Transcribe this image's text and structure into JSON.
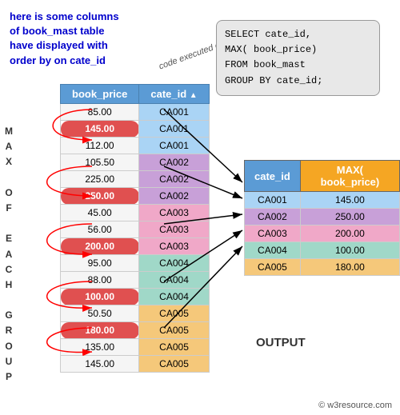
{
  "annotation": {
    "line1": "here is some columns",
    "line2": "of book_mast table",
    "line3": "have displayed with",
    "line4": "order by on cate_id"
  },
  "code_label": "code executed on this table",
  "sql": {
    "lines": [
      "SELECT cate_id,",
      "MAX( book_price)",
      "FROM book_mast",
      "GROUP BY cate_id;"
    ]
  },
  "side_label": "M\nA\nX\n \nO\nF\n \nE\nA\nC\nH\n \nG\nR\nO\nU\nP",
  "main_table": {
    "headers": [
      "book_price",
      "cate_id"
    ],
    "rows": [
      {
        "price": "85.00",
        "cate": "CA001",
        "group": "ca001",
        "is_max": false
      },
      {
        "price": "145.00",
        "cate": "CA001",
        "group": "ca001",
        "is_max": true
      },
      {
        "price": "112.00",
        "cate": "CA001",
        "group": "ca001",
        "is_max": false
      },
      {
        "price": "105.50",
        "cate": "CA002",
        "group": "ca002",
        "is_max": false
      },
      {
        "price": "225.00",
        "cate": "CA002",
        "group": "ca002",
        "is_max": false
      },
      {
        "price": "250.00",
        "cate": "CA002",
        "group": "ca002",
        "is_max": true
      },
      {
        "price": "45.00",
        "cate": "CA003",
        "group": "ca003",
        "is_max": false
      },
      {
        "price": "56.00",
        "cate": "CA003",
        "group": "ca003",
        "is_max": false
      },
      {
        "price": "200.00",
        "cate": "CA003",
        "group": "ca003",
        "is_max": true
      },
      {
        "price": "95.00",
        "cate": "CA004",
        "group": "ca004",
        "is_max": false
      },
      {
        "price": "88.00",
        "cate": "CA004",
        "group": "ca004",
        "is_max": false
      },
      {
        "price": "100.00",
        "cate": "CA004",
        "group": "ca004",
        "is_max": true
      },
      {
        "price": "50.50",
        "cate": "CA005",
        "group": "ca005",
        "is_max": false
      },
      {
        "price": "180.00",
        "cate": "CA005",
        "group": "ca005",
        "is_max": true
      },
      {
        "price": "135.00",
        "cate": "CA005",
        "group": "ca005",
        "is_max": false
      },
      {
        "price": "145.00",
        "cate": "CA005",
        "group": "ca005",
        "is_max": false
      }
    ]
  },
  "output_table": {
    "headers": [
      "cate_id",
      "MAX( book_price)"
    ],
    "rows": [
      {
        "cate": "CA001",
        "max": "145.00",
        "cls": "out-ca001"
      },
      {
        "cate": "CA002",
        "max": "250.00",
        "cls": "out-ca002"
      },
      {
        "cate": "CA003",
        "max": "200.00",
        "cls": "out-ca003"
      },
      {
        "cate": "CA004",
        "max": "100.00",
        "cls": "out-ca004"
      },
      {
        "cate": "CA005",
        "max": "180.00",
        "cls": "out-ca005"
      }
    ]
  },
  "output_label": "OUTPUT",
  "copyright": "© w3resource.com"
}
